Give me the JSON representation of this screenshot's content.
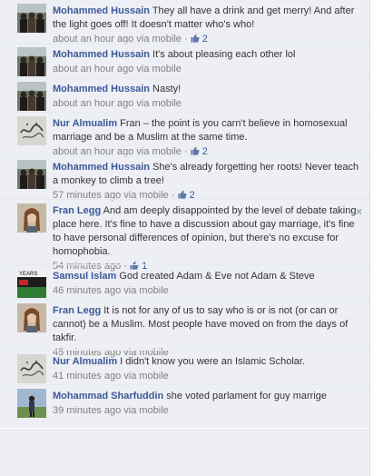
{
  "comments": [
    {
      "author": "Mohammed Hussain",
      "text": "They all have a drink and get merry! And after the light goes off! It doesn't matter who's who!",
      "time": "about an hour ago",
      "via": "via mobile",
      "likes": "2",
      "avatar": "crowd"
    },
    {
      "author": "Mohammed Hussain",
      "text": "It's about pleasing each other lol",
      "time": "about an hour ago",
      "via": "via mobile",
      "likes": "",
      "avatar": "crowd"
    },
    {
      "author": "Mohammed Hussain",
      "text": "Nasty!",
      "time": "about an hour ago",
      "via": "via mobile",
      "likes": "",
      "avatar": "crowd"
    },
    {
      "author": "Nur Almualim",
      "text": "Fran – the point is you carn't believe in homosexual marriage and be a Muslim at the same time.",
      "time": "about an hour ago",
      "via": "via mobile",
      "likes": "2",
      "avatar": "calligraphy"
    },
    {
      "author": "Mohammed Hussain",
      "text": "She's already forgetting her roots! Never teach a monkey to climb a tree!",
      "time": "57 minutes ago",
      "via": "via mobile",
      "likes": "2",
      "avatar": "crowd"
    },
    {
      "author": "Fran Legg",
      "text": "And am deeply disappointed by the level of debate taking place here. It's fine to have a discussion about gay marriage, it's fine to have personal differences of opinion, but there's no excuse for homophobia.",
      "time": "54 minutes ago",
      "via": "",
      "likes": "1",
      "avatar": "portrait",
      "removable": "×"
    },
    {
      "author": "Samsul Islam",
      "text": "God created Adam & Eve not Adam & Steve",
      "time": "46 minutes ago",
      "via": "via mobile",
      "likes": "",
      "avatar": "poster"
    },
    {
      "author": "Fran Legg",
      "text": "It is not for any of us to say who is or is not (or can or cannot) be a Muslim. Most people have moved on from the days of takfir.",
      "time": "45 minutes ago",
      "via": "via mobile",
      "likes": "",
      "avatar": "portrait"
    },
    {
      "author": "Nur Almualim",
      "text": "I didn't know you were an Islamic Scholar.",
      "time": "41 minutes ago",
      "via": "via mobile",
      "likes": "",
      "avatar": "calligraphy"
    },
    {
      "author": "Mohammad Sharfuddin",
      "text": "she voted parlament for guy marrige",
      "time": "39 minutes ago",
      "via": "via mobile",
      "likes": "",
      "avatar": "outdoor"
    }
  ],
  "colors": {
    "link": "#3b5998",
    "meta": "#808080",
    "background": "#edeff4"
  }
}
